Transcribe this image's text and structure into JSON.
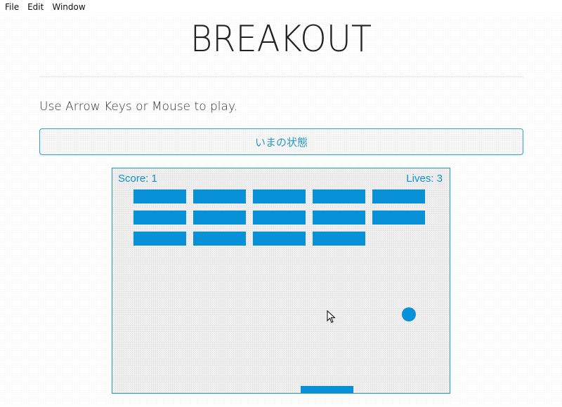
{
  "menu": [
    "File",
    "Edit",
    "Window"
  ],
  "title": "BREAKOUT",
  "instructions": "Use Arrow Keys or Mouse to play.",
  "state_button": "いまの状態",
  "hud": {
    "score": "Score: 1",
    "lives": "Lives: 3"
  },
  "colors": {
    "accent": "#0891d6",
    "border": "#2aa5c9",
    "text": "#333333"
  },
  "bricks": [
    [
      true,
      true,
      true,
      true,
      true
    ],
    [
      true,
      true,
      true,
      true,
      true
    ],
    [
      true,
      true,
      true,
      true,
      false
    ]
  ],
  "icons": {
    "cursor": "mouse-pointer-icon"
  }
}
